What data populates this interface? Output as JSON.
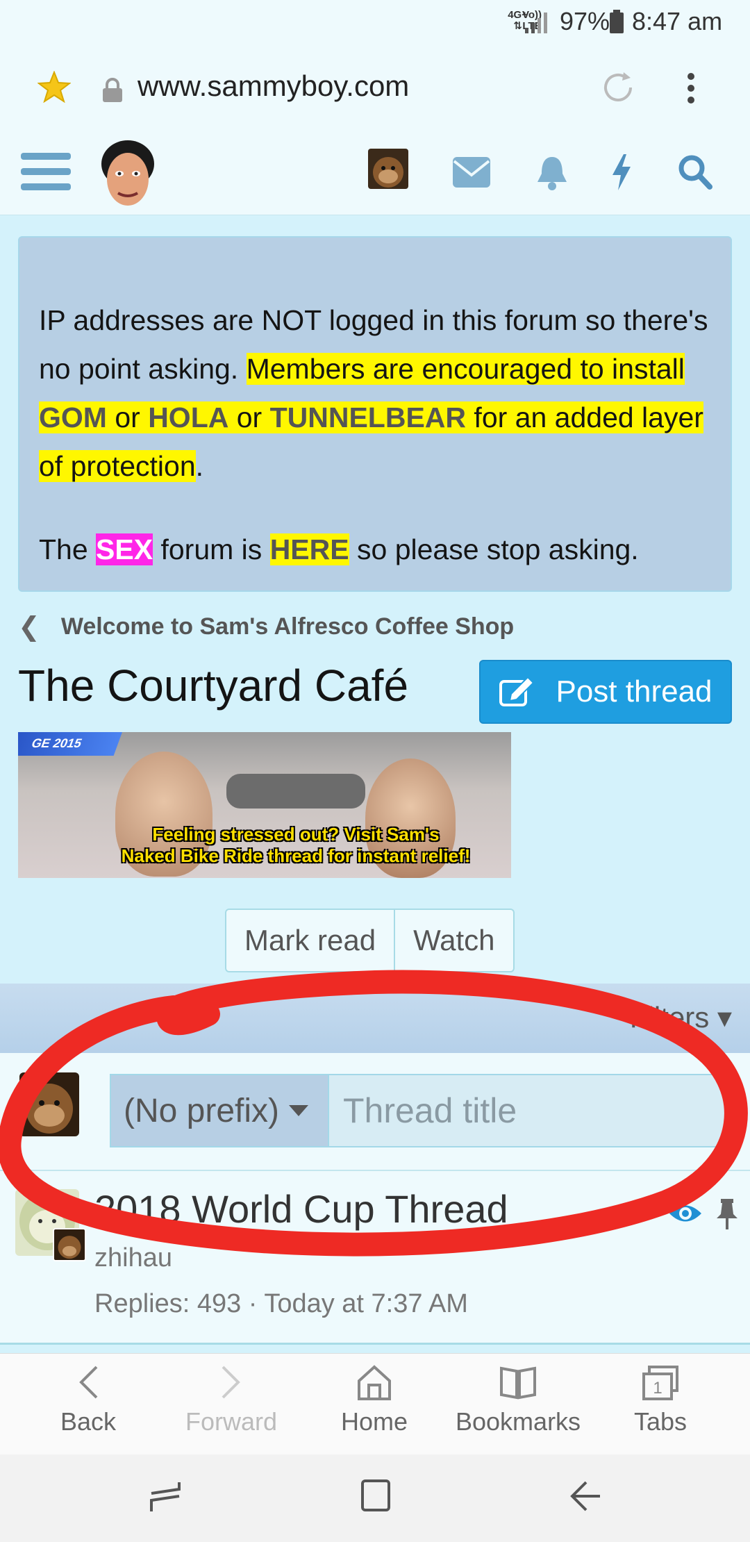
{
  "status_bar": {
    "net_top": "Vo))",
    "net_bottom": "LTE",
    "net2_top": "4G+",
    "net2_bottom": "⇅",
    "battery": "97%",
    "time": "8:47 am"
  },
  "address_bar": {
    "url": "www.sammyboy.com"
  },
  "notice": {
    "line_plain": "IP addresses are NOT logged in this forum so there's no point asking. ",
    "hl_1": "Members are encouraged to install ",
    "gom": "GOM",
    "or_1": " or ",
    "hola": "HOLA",
    "or_2": " or ",
    "tunnelbear": "TUNNELBEAR",
    "hl_2": " for an added layer of protection",
    "period": ".",
    "p2_the": "The ",
    "sex": "SEX",
    "p2_forum": " forum is ",
    "here": "HERE",
    "p2_end": " so please stop asking."
  },
  "breadcrumb": {
    "label": "Welcome to Sam's Alfresco Coffee Shop"
  },
  "page": {
    "title": "The Courtyard Café",
    "post_thread_label": "Post thread"
  },
  "banner": {
    "tag": "GE 2015",
    "caption_line1": "Feeling stressed out? Visit Sam's",
    "caption_line2": "Naked Bike Ride thread for instant relief!"
  },
  "actions": {
    "mark_read": "Mark read",
    "watch": "Watch"
  },
  "filters": {
    "label": "Filters ▾"
  },
  "quick_thread": {
    "prefix": "(No prefix)",
    "title_placeholder": "Thread title"
  },
  "threads": [
    {
      "title": "2018 World Cup Thread",
      "author": "zhihau",
      "meta": "Replies: 493 · Today at 7:37 AM"
    }
  ],
  "bottom_nav": {
    "back": "Back",
    "forward": "Forward",
    "home": "Home",
    "bookmarks": "Bookmarks",
    "tabs": "Tabs",
    "tabs_count": "1"
  },
  "colors": {
    "accent": "#1f9ee0",
    "highlight_yellow": "#fff700",
    "highlight_pink": "#ff26e8",
    "page_bg": "#d4f2fb",
    "marker_red": "#ee2a24"
  }
}
